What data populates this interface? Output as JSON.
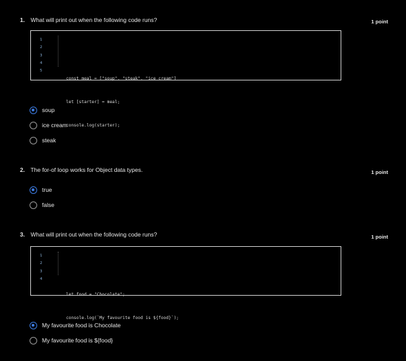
{
  "questions": [
    {
      "number": "1.",
      "text": "What will print out when the following code runs?",
      "points": "1 point",
      "line_numbers": [
        "1",
        "2",
        "3",
        "4",
        "5"
      ],
      "code": [
        "",
        "const meal = [\"soup\", \"steak\", \"ice cream\"]",
        "let [starter] = meal;",
        "console.log(starter);",
        ""
      ],
      "options": [
        {
          "label": "soup",
          "selected": true
        },
        {
          "label": "ice cream",
          "selected": false
        },
        {
          "label": "steak",
          "selected": false
        }
      ]
    },
    {
      "number": "2.",
      "text": "The for-of loop works for Object data types.",
      "points": "1 point",
      "options": [
        {
          "label": "true",
          "selected": true
        },
        {
          "label": "false",
          "selected": false
        }
      ]
    },
    {
      "number": "3.",
      "text": "What will print out when the following code runs?",
      "points": "1 point",
      "line_numbers": [
        "1",
        "2",
        "3",
        "4"
      ],
      "code": [
        "",
        "let food = \"Chocolate\";",
        "console.log(`My favourite food is ${food}`);",
        ""
      ],
      "options": [
        {
          "label": "My favourite food is Chocolate",
          "selected": true
        },
        {
          "label": "My favourite food is ${food}",
          "selected": false
        }
      ]
    }
  ],
  "colors": {
    "background": "#000000",
    "accent": "#3d7be0",
    "text": "#e6e6e6",
    "border": "#cfcfcf",
    "line_number": "#8ab0d8"
  }
}
